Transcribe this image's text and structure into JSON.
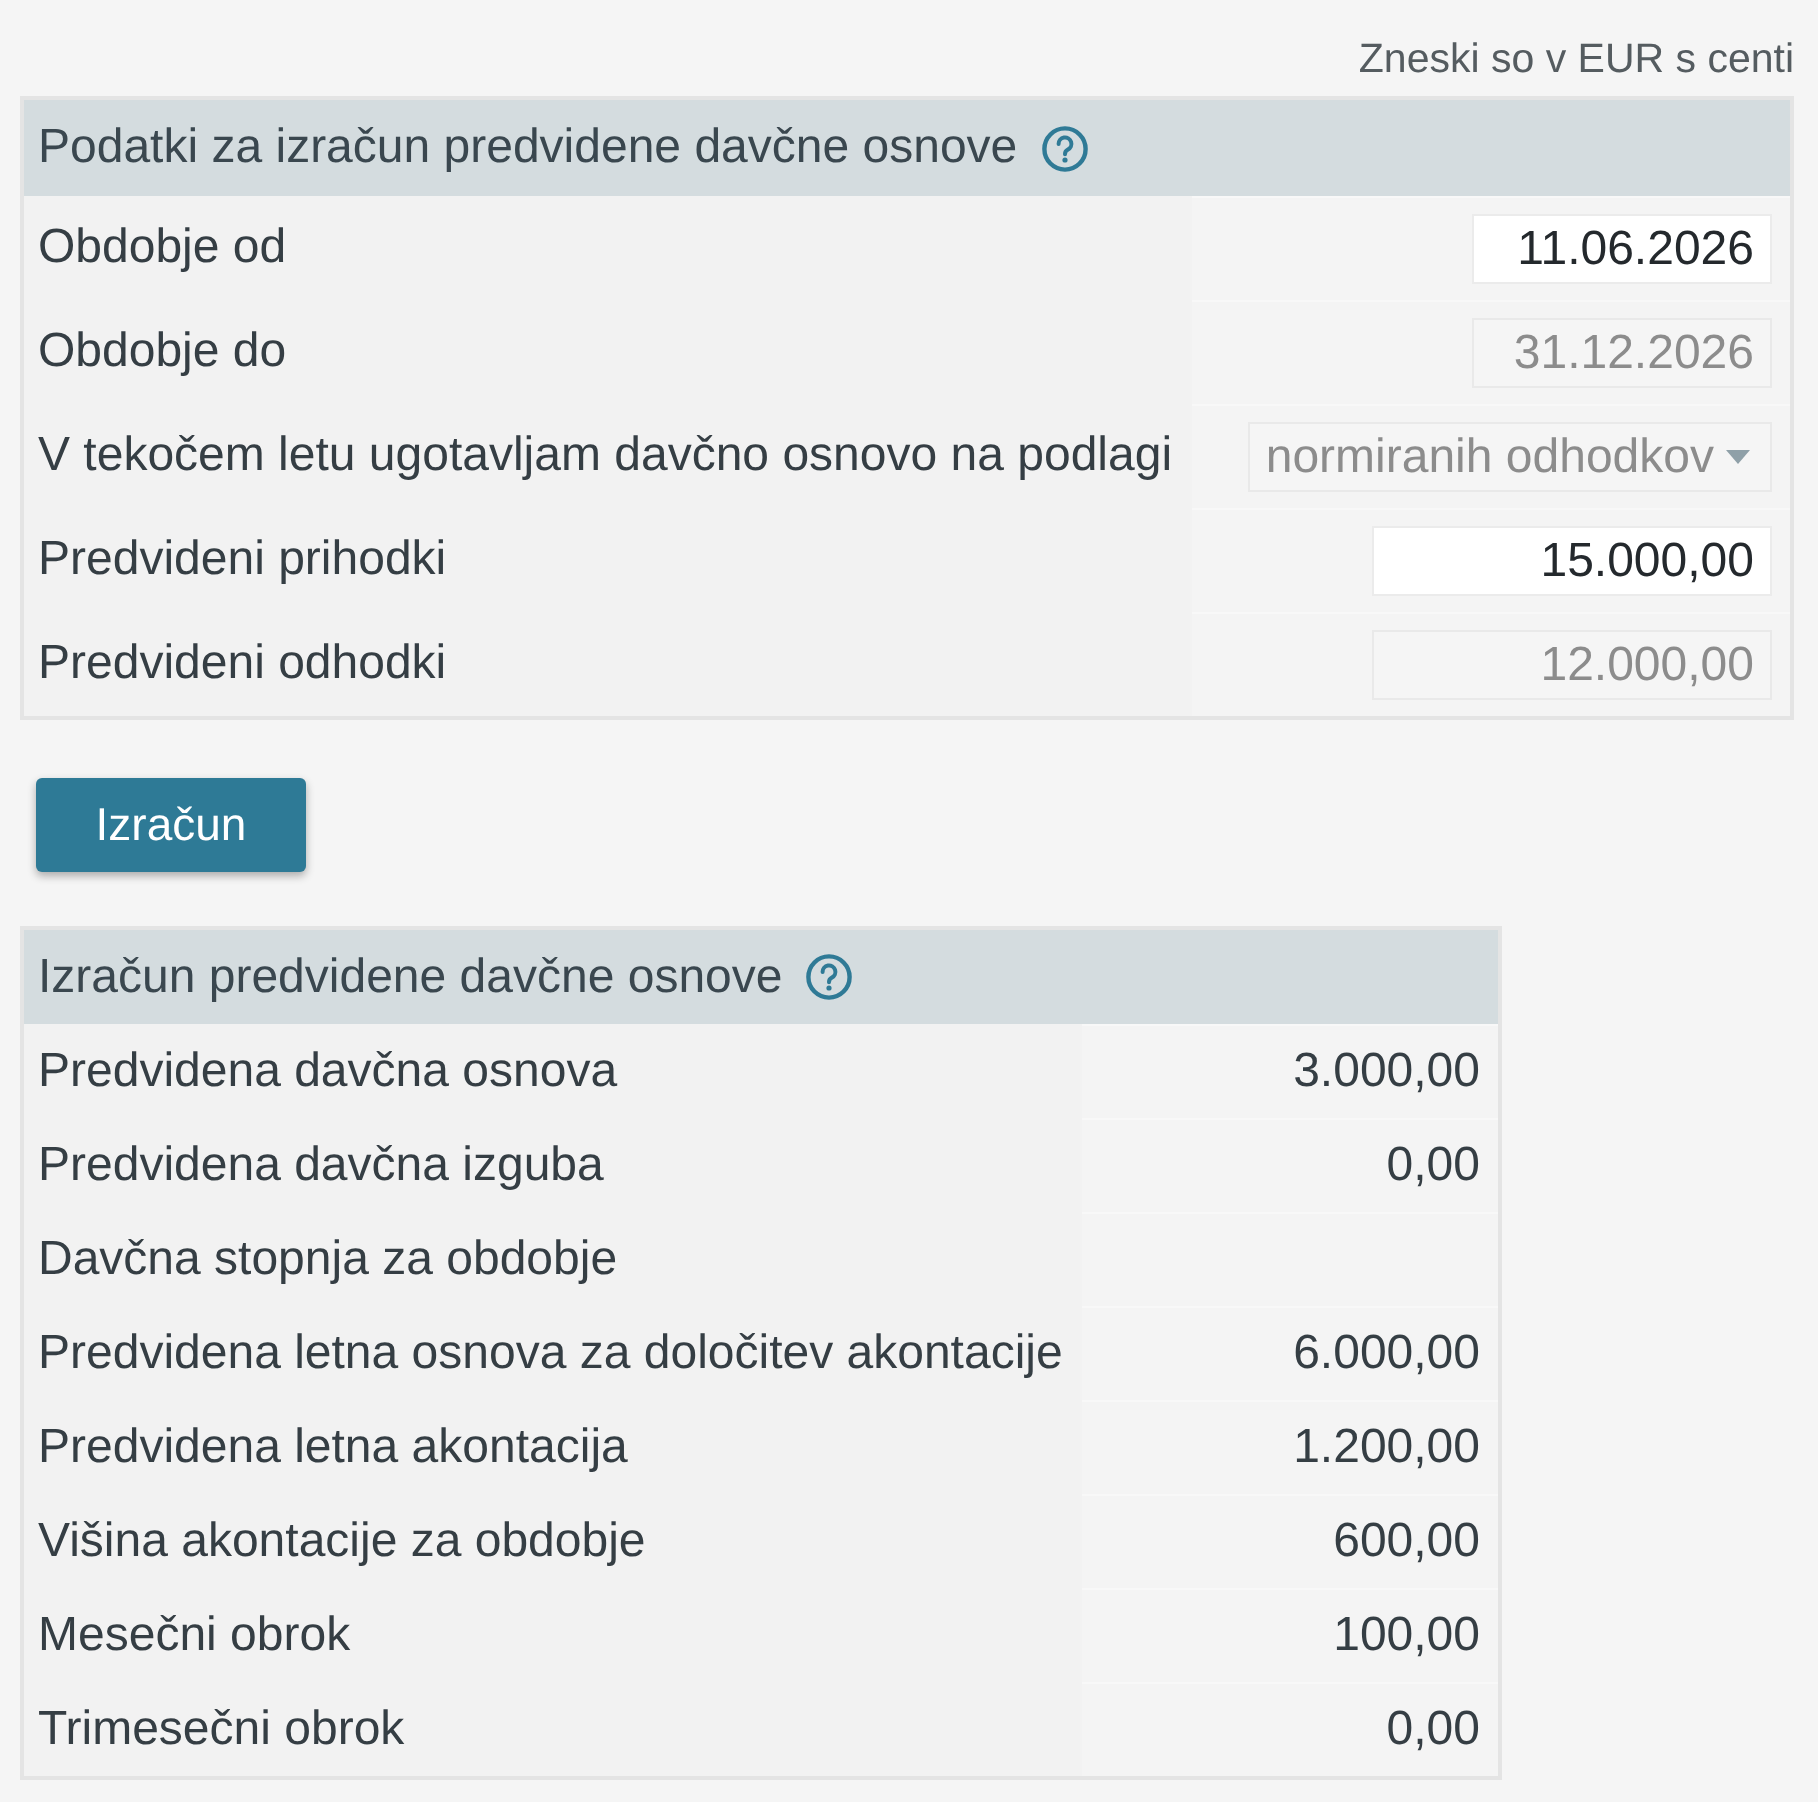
{
  "note": "Zneski so v EUR s centi",
  "input_panel": {
    "title": "Podatki za izračun predvidene davčne osnove",
    "fields": [
      {
        "label": "Obdobje od",
        "kind": "date",
        "value": "11.06.2026",
        "disabled": false
      },
      {
        "label": "Obdobje do",
        "kind": "date",
        "value": "31.12.2026",
        "disabled": true
      },
      {
        "label": "V tekočem letu ugotavljam davčno osnovo na podlagi",
        "kind": "select",
        "value": "normiranih odhodkov",
        "disabled": true
      },
      {
        "label": "Predvideni prihodki",
        "kind": "amount",
        "value": "15.000,00",
        "disabled": false
      },
      {
        "label": "Predvideni odhodki",
        "kind": "amount",
        "value": "12.000,00",
        "disabled": true
      }
    ]
  },
  "calculate_button": "Izračun",
  "result_panel": {
    "title": "Izračun predvidene davčne osnove",
    "rows": [
      {
        "label": "Predvidena davčna osnova",
        "value": "3.000,00"
      },
      {
        "label": "Predvidena davčna izguba",
        "value": "0,00"
      },
      {
        "label": "Davčna stopnja za obdobje"
      },
      {
        "label": "Predvidena letna osnova za določitev akontacije",
        "value": "6.000,00"
      },
      {
        "label": "Predvidena letna akontacija",
        "value": "1.200,00"
      },
      {
        "label": "Višina akontacije za obdobje",
        "value": "600,00"
      },
      {
        "label": "Mesečni obrok",
        "value": "100,00"
      },
      {
        "label": "Trimesečni obrok",
        "value": "0,00"
      }
    ]
  }
}
